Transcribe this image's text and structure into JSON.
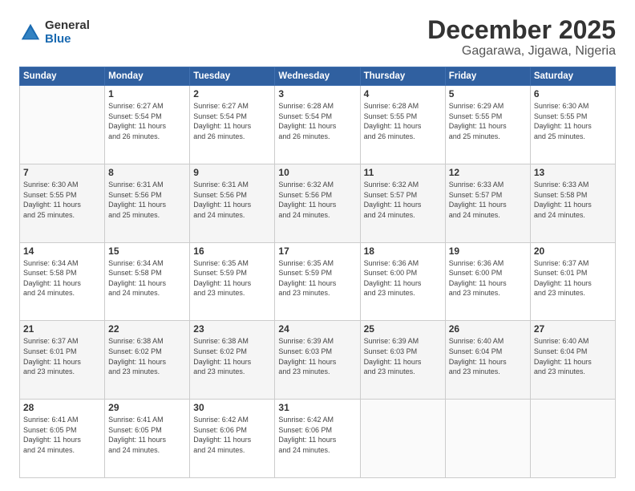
{
  "logo": {
    "general": "General",
    "blue": "Blue"
  },
  "header": {
    "month": "December 2025",
    "location": "Gagarawa, Jigawa, Nigeria"
  },
  "weekdays": [
    "Sunday",
    "Monday",
    "Tuesday",
    "Wednesday",
    "Thursday",
    "Friday",
    "Saturday"
  ],
  "weeks": [
    [
      {
        "day": "",
        "info": ""
      },
      {
        "day": "1",
        "info": "Sunrise: 6:27 AM\nSunset: 5:54 PM\nDaylight: 11 hours\nand 26 minutes."
      },
      {
        "day": "2",
        "info": "Sunrise: 6:27 AM\nSunset: 5:54 PM\nDaylight: 11 hours\nand 26 minutes."
      },
      {
        "day": "3",
        "info": "Sunrise: 6:28 AM\nSunset: 5:54 PM\nDaylight: 11 hours\nand 26 minutes."
      },
      {
        "day": "4",
        "info": "Sunrise: 6:28 AM\nSunset: 5:55 PM\nDaylight: 11 hours\nand 26 minutes."
      },
      {
        "day": "5",
        "info": "Sunrise: 6:29 AM\nSunset: 5:55 PM\nDaylight: 11 hours\nand 25 minutes."
      },
      {
        "day": "6",
        "info": "Sunrise: 6:30 AM\nSunset: 5:55 PM\nDaylight: 11 hours\nand 25 minutes."
      }
    ],
    [
      {
        "day": "7",
        "info": "Sunrise: 6:30 AM\nSunset: 5:55 PM\nDaylight: 11 hours\nand 25 minutes."
      },
      {
        "day": "8",
        "info": "Sunrise: 6:31 AM\nSunset: 5:56 PM\nDaylight: 11 hours\nand 25 minutes."
      },
      {
        "day": "9",
        "info": "Sunrise: 6:31 AM\nSunset: 5:56 PM\nDaylight: 11 hours\nand 24 minutes."
      },
      {
        "day": "10",
        "info": "Sunrise: 6:32 AM\nSunset: 5:56 PM\nDaylight: 11 hours\nand 24 minutes."
      },
      {
        "day": "11",
        "info": "Sunrise: 6:32 AM\nSunset: 5:57 PM\nDaylight: 11 hours\nand 24 minutes."
      },
      {
        "day": "12",
        "info": "Sunrise: 6:33 AM\nSunset: 5:57 PM\nDaylight: 11 hours\nand 24 minutes."
      },
      {
        "day": "13",
        "info": "Sunrise: 6:33 AM\nSunset: 5:58 PM\nDaylight: 11 hours\nand 24 minutes."
      }
    ],
    [
      {
        "day": "14",
        "info": "Sunrise: 6:34 AM\nSunset: 5:58 PM\nDaylight: 11 hours\nand 24 minutes."
      },
      {
        "day": "15",
        "info": "Sunrise: 6:34 AM\nSunset: 5:58 PM\nDaylight: 11 hours\nand 24 minutes."
      },
      {
        "day": "16",
        "info": "Sunrise: 6:35 AM\nSunset: 5:59 PM\nDaylight: 11 hours\nand 23 minutes."
      },
      {
        "day": "17",
        "info": "Sunrise: 6:35 AM\nSunset: 5:59 PM\nDaylight: 11 hours\nand 23 minutes."
      },
      {
        "day": "18",
        "info": "Sunrise: 6:36 AM\nSunset: 6:00 PM\nDaylight: 11 hours\nand 23 minutes."
      },
      {
        "day": "19",
        "info": "Sunrise: 6:36 AM\nSunset: 6:00 PM\nDaylight: 11 hours\nand 23 minutes."
      },
      {
        "day": "20",
        "info": "Sunrise: 6:37 AM\nSunset: 6:01 PM\nDaylight: 11 hours\nand 23 minutes."
      }
    ],
    [
      {
        "day": "21",
        "info": "Sunrise: 6:37 AM\nSunset: 6:01 PM\nDaylight: 11 hours\nand 23 minutes."
      },
      {
        "day": "22",
        "info": "Sunrise: 6:38 AM\nSunset: 6:02 PM\nDaylight: 11 hours\nand 23 minutes."
      },
      {
        "day": "23",
        "info": "Sunrise: 6:38 AM\nSunset: 6:02 PM\nDaylight: 11 hours\nand 23 minutes."
      },
      {
        "day": "24",
        "info": "Sunrise: 6:39 AM\nSunset: 6:03 PM\nDaylight: 11 hours\nand 23 minutes."
      },
      {
        "day": "25",
        "info": "Sunrise: 6:39 AM\nSunset: 6:03 PM\nDaylight: 11 hours\nand 23 minutes."
      },
      {
        "day": "26",
        "info": "Sunrise: 6:40 AM\nSunset: 6:04 PM\nDaylight: 11 hours\nand 23 minutes."
      },
      {
        "day": "27",
        "info": "Sunrise: 6:40 AM\nSunset: 6:04 PM\nDaylight: 11 hours\nand 23 minutes."
      }
    ],
    [
      {
        "day": "28",
        "info": "Sunrise: 6:41 AM\nSunset: 6:05 PM\nDaylight: 11 hours\nand 24 minutes."
      },
      {
        "day": "29",
        "info": "Sunrise: 6:41 AM\nSunset: 6:05 PM\nDaylight: 11 hours\nand 24 minutes."
      },
      {
        "day": "30",
        "info": "Sunrise: 6:42 AM\nSunset: 6:06 PM\nDaylight: 11 hours\nand 24 minutes."
      },
      {
        "day": "31",
        "info": "Sunrise: 6:42 AM\nSunset: 6:06 PM\nDaylight: 11 hours\nand 24 minutes."
      },
      {
        "day": "",
        "info": ""
      },
      {
        "day": "",
        "info": ""
      },
      {
        "day": "",
        "info": ""
      }
    ]
  ]
}
